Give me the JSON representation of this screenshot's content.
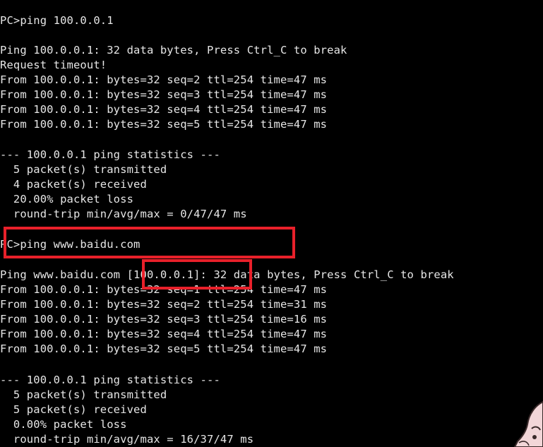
{
  "terminal": {
    "lines": [
      "PC>ping 100.0.0.1",
      "",
      "Ping 100.0.0.1: 32 data bytes, Press Ctrl_C to break",
      "Request timeout!",
      "From 100.0.0.1: bytes=32 seq=2 ttl=254 time=47 ms",
      "From 100.0.0.1: bytes=32 seq=3 ttl=254 time=47 ms",
      "From 100.0.0.1: bytes=32 seq=4 ttl=254 time=47 ms",
      "From 100.0.0.1: bytes=32 seq=5 ttl=254 time=47 ms",
      "",
      "--- 100.0.0.1 ping statistics ---",
      "  5 packet(s) transmitted",
      "  4 packet(s) received",
      "  20.00% packet loss",
      "  round-trip min/avg/max = 0/47/47 ms",
      "",
      "PC>ping www.baidu.com",
      "",
      "Ping www.baidu.com [100.0.0.1]: 32 data bytes, Press Ctrl_C to break",
      "From 100.0.0.1: bytes=32 seq=1 ttl=254 time=47 ms",
      "From 100.0.0.1: bytes=32 seq=2 ttl=254 time=31 ms",
      "From 100.0.0.1: bytes=32 seq=3 ttl=254 time=16 ms",
      "From 100.0.0.1: bytes=32 seq=4 ttl=254 time=47 ms",
      "From 100.0.0.1: bytes=32 seq=5 ttl=254 time=47 ms",
      "",
      "--- 100.0.0.1 ping statistics ---",
      "  5 packet(s) transmitted",
      "  5 packet(s) received",
      "  0.00% packet loss",
      "  round-trip min/avg/max = 16/37/47 ms"
    ]
  },
  "colors": {
    "background": "#000000",
    "text": "#e6e6e6",
    "highlight": "#e8202a"
  }
}
